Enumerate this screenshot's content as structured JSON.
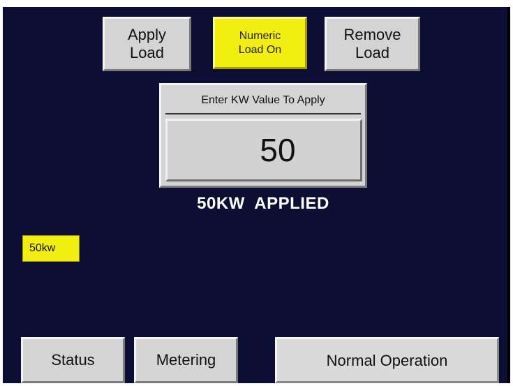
{
  "top_buttons": {
    "apply_load": {
      "line1": "Apply",
      "line2": "Load"
    },
    "numeric_load_on": {
      "line1": "Numeric",
      "line2": "Load On"
    },
    "remove_load": {
      "line1": "Remove",
      "line2": "Load"
    }
  },
  "entry": {
    "label": "Enter KW Value To Apply",
    "value": "50"
  },
  "applied_message": "50KW  APPLIED",
  "load_badge": "50kw",
  "bottom": {
    "status_label": "Status",
    "metering_label": "Metering",
    "operation_status": "Normal Operation"
  },
  "colors": {
    "background": "#0d0e33",
    "button_gray": "#d4d4d4",
    "highlight_yellow": "#f2ee12",
    "message_white": "#ffffff"
  }
}
